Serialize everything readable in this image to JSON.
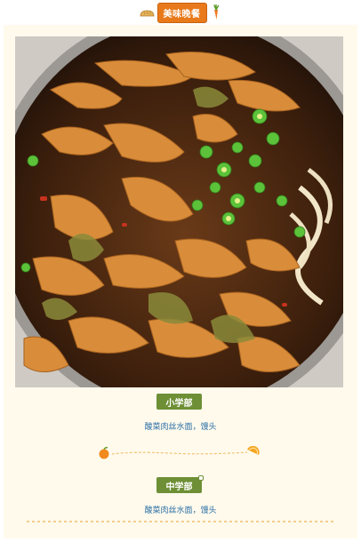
{
  "header": {
    "title": "美味晚餐",
    "left_icon": "bread-icon",
    "right_icon": "carrot-icon"
  },
  "photo": {
    "icon": "food-photo"
  },
  "sections": [
    {
      "badge": "小学部",
      "menu": "酸菜肉丝水面，馒头"
    },
    {
      "badge": "中学部",
      "menu": "酸菜肉丝水面，馒头"
    }
  ],
  "divider": {
    "left_icon": "orange-icon",
    "right_icon": "orange-slice-icon"
  },
  "colors": {
    "header_badge": "#e87a1c",
    "section_badge": "#6e8f35",
    "menu_text": "#2a6fa6",
    "page_bg": "#fffaec"
  }
}
